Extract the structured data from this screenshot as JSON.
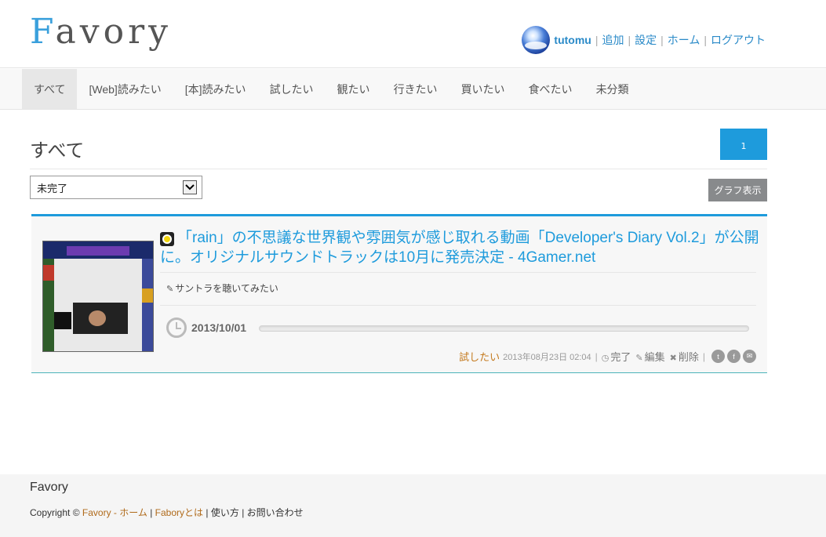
{
  "header": {
    "logo_first": "F",
    "logo_rest": "avory",
    "username": "tutomu",
    "links": [
      "追加",
      "設定",
      "ホーム",
      "ログアウト"
    ]
  },
  "nav": {
    "items": [
      "すべて",
      "[Web]読みたい",
      "[本]読みたい",
      "試したい",
      "観たい",
      "行きたい",
      "買いたい",
      "食べたい",
      "未分類"
    ],
    "active_index": 0
  },
  "main": {
    "page_title": "すべて",
    "pager_current": "1",
    "filter_value": "未完了",
    "graph_button": "グラフ表示"
  },
  "item": {
    "title": "「rain」の不思議な世界観や雰囲気が感じ取れる動画「Developer's Diary Vol.2」が公開に。オリジナルサウンドトラックは10月に発売決定 - 4Gamer.net",
    "memo": "サントラを聴いてみたい",
    "due_date": "2013/10/01",
    "progress_fraction": 0,
    "category": "試したい",
    "registered": "2013年08月23日 02:04",
    "actions": {
      "complete": "完了",
      "edit": "編集",
      "delete": "削除"
    },
    "share": [
      "twitter-icon",
      "facebook-icon",
      "mail-icon"
    ]
  },
  "footer": {
    "brand": "Favory",
    "copyright_prefix": "Copyright ©",
    "home_link": "Favory - ホーム",
    "about_link": "Faboryとは",
    "usage_link": "使い方",
    "contact_link": "お問い合わせ"
  },
  "colors": {
    "accent": "#1e9bdc",
    "category": "#c47a1e",
    "button_gray": "#888a8c"
  }
}
